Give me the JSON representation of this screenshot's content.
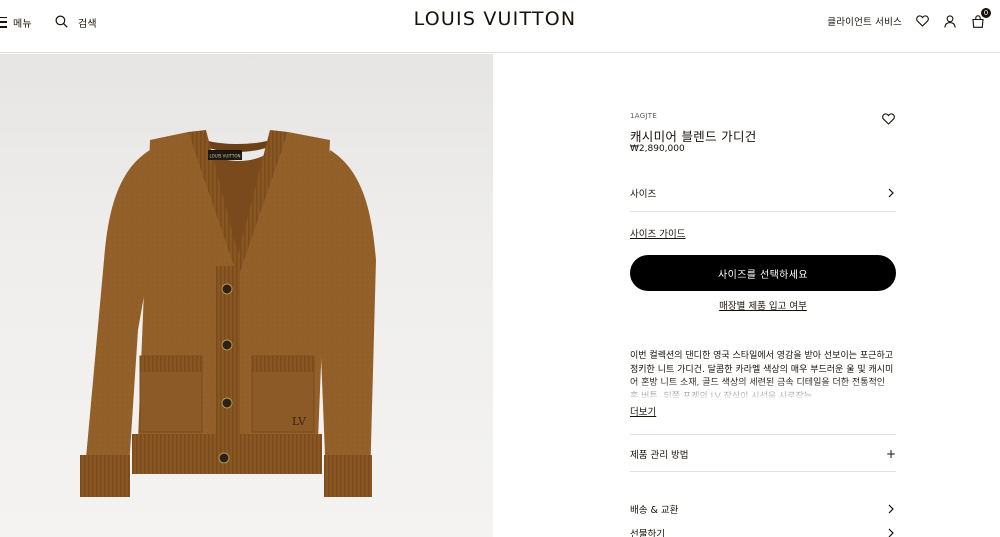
{
  "header": {
    "menu_label": "메뉴",
    "search_label": "검색",
    "logo": "LOUIS VUITTON",
    "client_services": "클라이언트 서비스",
    "bag_count": "0",
    "icons": [
      "menu-icon",
      "search-icon",
      "heart-icon",
      "account-icon",
      "shopping-bag-icon"
    ]
  },
  "product": {
    "sku": "1AGJTE",
    "name": "캐시미어 블렌드 가디건",
    "price": "₩2,890,000",
    "size_label": "사이즈",
    "size_guide": "사이즈 가이드",
    "cta": "사이즈를 선택하세요",
    "store_stock": "매장별 제품 입고 여부",
    "description": "이번 컬렉션의 댄디한 영국 스타일에서 영감을 받아 선보이는 포근하고 정키한 니트 가디건. 달콤한 카라멜 색상의 매우 부드러운 울 및 캐시미어 혼방 니트 소재, 골드 색상의 세련된 금속 디테일을 더한 전통적인 혼 버튼, 뒤쪽 포켓의 LV 장식이 시선을 사로잡는",
    "read_more": "더보기",
    "care_label": "제품 관리 방법",
    "shipping_label": "배송 & 교환",
    "gift_label": "선물하기",
    "garment_label": "LOUIS VUITTON"
  },
  "colors": {
    "text": "#19110b",
    "cta_bg": "#000000",
    "knit": "#8e5a25"
  }
}
